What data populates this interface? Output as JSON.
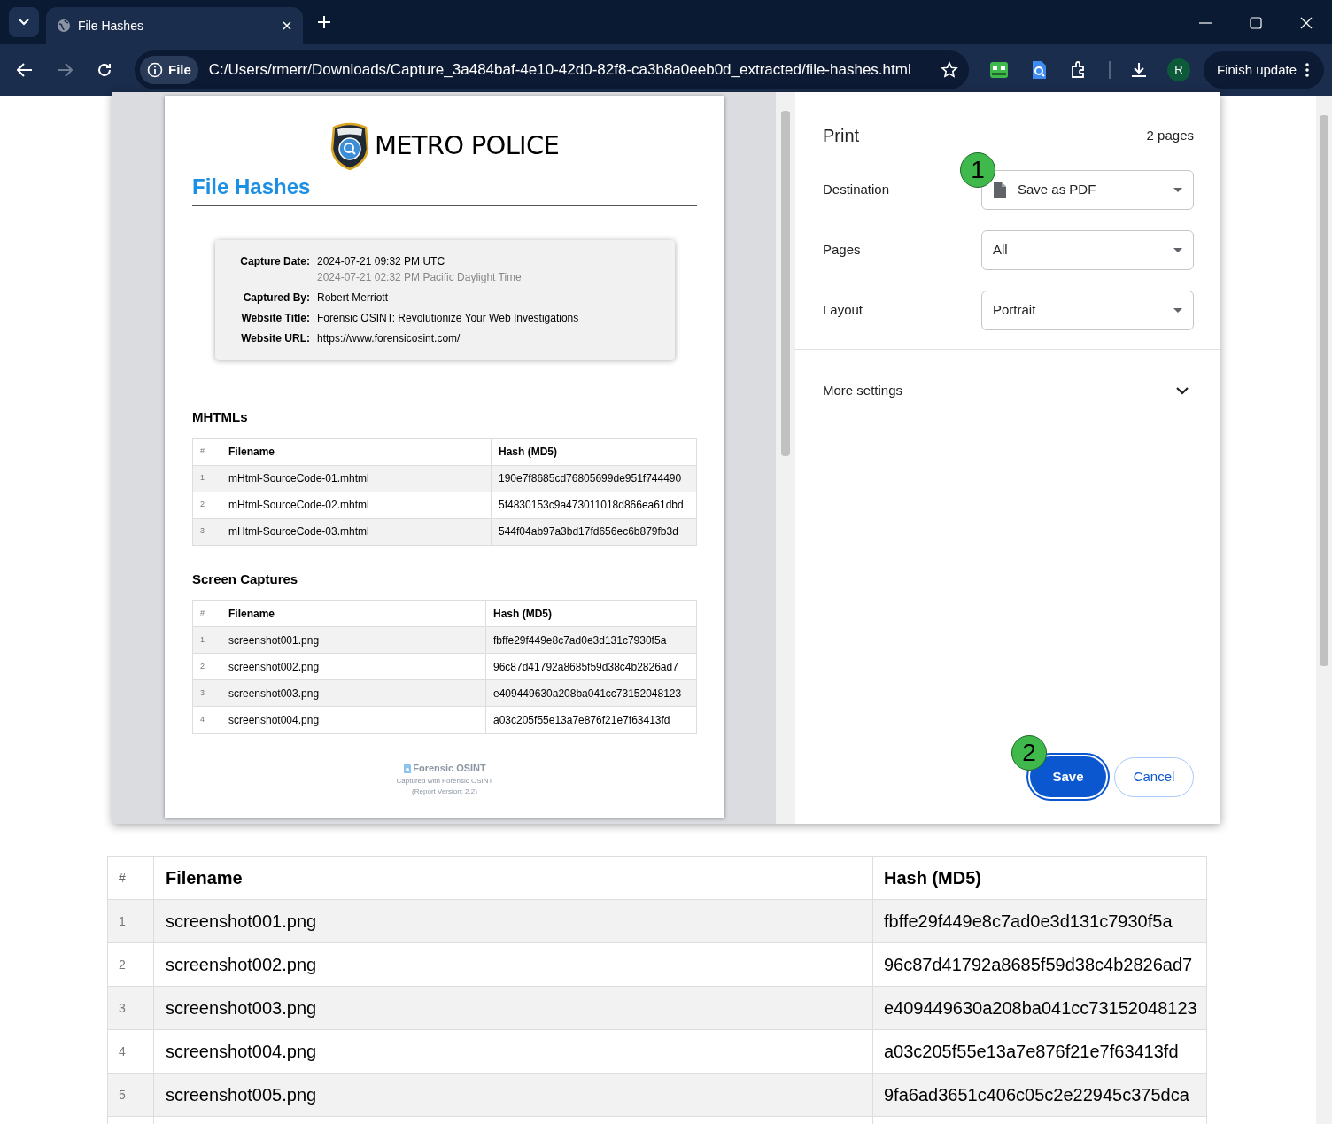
{
  "browser": {
    "tab": {
      "title": "File Hashes"
    },
    "address": {
      "chip": "File",
      "url": "C:/Users/rmerr/Downloads/Capture_3a484baf-4e10-42d0-82f8-ca3b8a0eeb0d_extracted/file-hashes.html"
    },
    "profile": "R",
    "update_button": "Finish update"
  },
  "page": {
    "table": {
      "columns": [
        "#",
        "Filename",
        "Hash (MD5)"
      ],
      "rows": [
        [
          "1",
          "screenshot001.png",
          "fbffe29f449e8c7ad0e3d131c7930f5a"
        ],
        [
          "2",
          "screenshot002.png",
          "96c87d41792a8685f59d38c4b2826ad7"
        ],
        [
          "3",
          "screenshot003.png",
          "e409449630a208ba041cc73152048123"
        ],
        [
          "4",
          "screenshot004.png",
          "a03c205f55e13a7e876f21e7f63413fd"
        ],
        [
          "5",
          "screenshot005.png",
          "9fa6ad3651c406c05c2e22945c375dca"
        ]
      ]
    }
  },
  "print_preview": {
    "org": "METRO POLICE",
    "title": "File Hashes",
    "info": [
      {
        "label": "Capture Date:",
        "value": "2024-07-21 09:32 PM UTC",
        "note": "2024-07-21 02:32 PM Pacific Daylight Time"
      },
      {
        "label": "Captured By:",
        "value": "Robert Merriott"
      },
      {
        "label": "Website Title:",
        "value": "Forensic OSINT: Revolutionize Your Web Investigations"
      },
      {
        "label": "Website URL:",
        "value": "https://www.forensicosint.com/"
      }
    ],
    "sections": [
      {
        "title": "MHTMLs",
        "columns": [
          "#",
          "Filename",
          "Hash (MD5)"
        ],
        "rows": [
          [
            "1",
            "mHtml-SourceCode-01.mhtml",
            "190e7f8685cd76805699de951f744490"
          ],
          [
            "2",
            "mHtml-SourceCode-02.mhtml",
            "5f4830153c9a473011018d866ea61dbd"
          ],
          [
            "3",
            "mHtml-SourceCode-03.mhtml",
            "544f04ab97a3bd17fd656ec6b879fb3d"
          ]
        ]
      },
      {
        "title": "Screen Captures",
        "columns": [
          "#",
          "Filename",
          "Hash (MD5)"
        ],
        "rows": [
          [
            "1",
            "screenshot001.png",
            "fbffe29f449e8c7ad0e3d131c7930f5a"
          ],
          [
            "2",
            "screenshot002.png",
            "96c87d41792a8685f59d38c4b2826ad7"
          ],
          [
            "3",
            "screenshot003.png",
            "e409449630a208ba041cc73152048123"
          ],
          [
            "4",
            "screenshot004.png",
            "a03c205f55e13a7e876f21e7f63413fd"
          ]
        ]
      }
    ],
    "footer": {
      "brand": "Forensic OSINT",
      "caption": "Captured with Forensic OSINT",
      "version": "(Report Version: 2.2)"
    }
  },
  "print_dialog": {
    "title": "Print",
    "page_count": "2 pages",
    "settings": [
      {
        "label": "Destination",
        "value": "Save as PDF",
        "kind": "destination"
      },
      {
        "label": "Pages",
        "value": "All",
        "kind": "select"
      },
      {
        "label": "Layout",
        "value": "Portrait",
        "kind": "select"
      }
    ],
    "more_settings": {
      "label": "More settings",
      "expanded": false
    },
    "save": "Save",
    "cancel": "Cancel"
  },
  "callouts": [
    "1",
    "2"
  ]
}
